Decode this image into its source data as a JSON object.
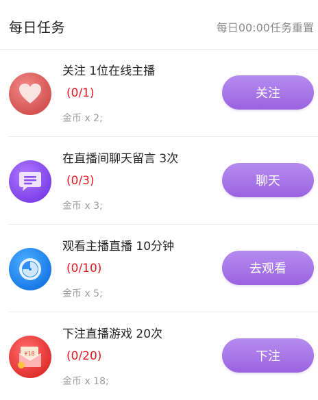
{
  "header": {
    "title": "每日任务",
    "reset_note": "每日00:00任务重置"
  },
  "tasks": [
    {
      "title": "关注 1位在线主播",
      "progress": "(0/1)",
      "reward": "金币 x 2;",
      "button": "关注",
      "icon": "heart-icon",
      "icon_color": "#e0605f"
    },
    {
      "title": "在直播间聊天留言 3次",
      "progress": "(0/3)",
      "reward": "金币 x 3;",
      "button": "聊天",
      "icon": "chat-icon",
      "icon_color": "#8c4ff0"
    },
    {
      "title": "观看主播直播 10分钟",
      "progress": "(0/10)",
      "reward": "金币 x 5;",
      "button": "去观看",
      "icon": "clock-icon",
      "icon_color": "#1e86f0"
    },
    {
      "title": "下注直播游戏 20次",
      "progress": "(0/20)",
      "reward": "金币 x 18;",
      "button": "下注",
      "icon": "red-envelope-icon",
      "icon_color": "#f04545",
      "icon_text": "¥18"
    }
  ]
}
